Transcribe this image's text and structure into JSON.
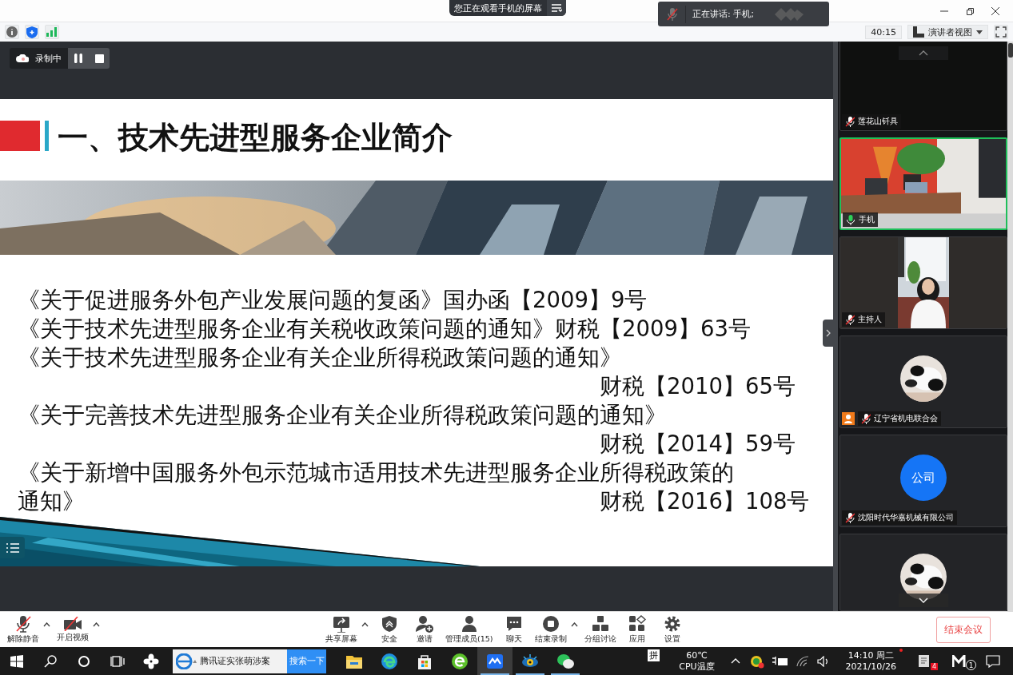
{
  "screen_share_banner": {
    "text": "您正在观看手机的屏幕"
  },
  "speaker_toast": {
    "label": "正在讲话: 手机;"
  },
  "toolbar": {
    "timer": "40:15",
    "view_mode": "演讲者视图"
  },
  "recording": {
    "label": "录制中"
  },
  "slide": {
    "title": "一、技术先进型服务企业简介",
    "lines": [
      {
        "kind": "citation",
        "text": "《关于促进服务外包产业发展问题的复函》国办函【2009】9号"
      },
      {
        "kind": "citation",
        "text": "《关于技术先进型服务企业有关税收政策问题的通知》财税【2009】63号"
      },
      {
        "kind": "citation",
        "text": "《关于技术先进型服务企业有关企业所得税政策问题的通知》"
      },
      {
        "kind": "number",
        "text": "财税【2010】65号"
      },
      {
        "kind": "citation",
        "text": "《关于完善技术先进型服务企业有关企业所得税政策问题的通知》"
      },
      {
        "kind": "number",
        "text": "财税【2014】59号"
      },
      {
        "kind": "citation",
        "text": "《关于新增中国服务外包示范城市适用技术先进型服务企业所得税政策的"
      },
      {
        "kind": "split",
        "text": "通知》",
        "number": "财税【2016】108号"
      }
    ]
  },
  "participants": [
    {
      "kind": "blank",
      "name": "莲花山钎具",
      "muted": true,
      "speaking": false,
      "host_badge": false
    },
    {
      "kind": "video",
      "name": "手机",
      "muted": false,
      "speaking": true,
      "host_badge": false
    },
    {
      "kind": "video",
      "name": "主持人",
      "muted": true,
      "speaking": false,
      "host_badge": false
    },
    {
      "kind": "avatar",
      "name": "辽宁省机电联合会",
      "muted": true,
      "speaking": false,
      "host_badge": true
    },
    {
      "kind": "initials",
      "initials": "公司",
      "name": "沈阳时代华嘉机械有限公司",
      "muted": true,
      "speaking": false,
      "host_badge": false
    },
    {
      "kind": "avatar",
      "speaking": false,
      "host_badge": false
    }
  ],
  "meeting_controls": {
    "left": [
      {
        "label": "解除静音",
        "has_menu": true
      },
      {
        "label": "开启视频",
        "has_menu": true
      }
    ],
    "center": [
      {
        "label": "共享屏幕",
        "has_menu": true
      },
      {
        "label": "安全",
        "has_menu": false
      },
      {
        "label": "邀请",
        "has_menu": false
      },
      {
        "label": "管理成员(15)",
        "has_menu": false
      },
      {
        "label": "聊天",
        "has_menu": false
      },
      {
        "label": "结束录制",
        "has_menu": true
      },
      {
        "label": "分组讨论",
        "has_menu": false
      },
      {
        "label": "应用",
        "has_menu": false
      },
      {
        "label": "设置",
        "has_menu": false
      }
    ],
    "end_button": "结束会议"
  },
  "taskbar": {
    "search_text": "腾讯证实张萌涉案",
    "search_button": "搜索一下",
    "apps": [
      {
        "active": false,
        "running": false
      },
      {
        "active": false,
        "running": false
      },
      {
        "active": false,
        "running": false
      },
      {
        "active": false,
        "running": false
      },
      {
        "active": true,
        "running": true
      },
      {
        "active": false,
        "running": true
      },
      {
        "active": false,
        "running": true
      }
    ],
    "ime": "拼",
    "temperature": "60℃",
    "temperature_label": "CPU温度",
    "time": "14:10 周二",
    "date": "2021/10/26",
    "notes_badge": "4",
    "m_badge": "1"
  }
}
